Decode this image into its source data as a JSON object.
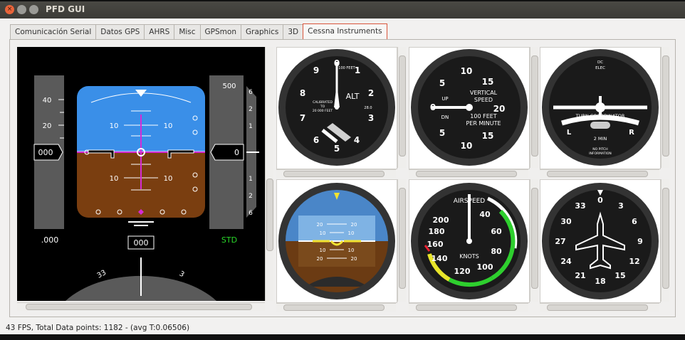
{
  "window": {
    "title": "PFD GUI",
    "close_glyph": "×"
  },
  "tabs": [
    "Comunicación Serial",
    "Datos GPS",
    "AHRS",
    "Misc",
    "GPSmon",
    "Graphics",
    "3D",
    "Cessna Instruments"
  ],
  "active_tab": 7,
  "status": {
    "text": "43 FPS, Total Data points: 1182 - (avg T:0.06506)"
  },
  "pfd": {
    "airspeed": "000",
    "airspeed_ticks": [
      "40",
      "20"
    ],
    "altitude": "0",
    "altitude_tick": "500",
    "vsi_ticks": [
      "6",
      "2",
      "1",
      "1",
      "2",
      "6"
    ],
    "mach": ".000",
    "baro": "STD",
    "heading": "000",
    "heading_ticks": [
      "33",
      "3"
    ],
    "pitch_labels": [
      "10",
      "10",
      "10",
      "10"
    ]
  },
  "gauges": {
    "altimeter": {
      "label": "ALT",
      "sub1": "100 FEET",
      "sub2": "CALIBRATED",
      "sub3": "TO",
      "sub4": "20 000 FEET",
      "baro": "28.0",
      "numbers": [
        "0",
        "1",
        "2",
        "3",
        "4",
        "5",
        "6",
        "7",
        "8",
        "9"
      ]
    },
    "vsi": {
      "top": "VERTICAL",
      "mid": "SPEED",
      "unit1": "100 FEET",
      "unit2": "PER MINUTE",
      "up": "UP",
      "dn": "DN",
      "numbers": [
        "0",
        "5",
        "10",
        "15",
        "20",
        "15",
        "10",
        "5"
      ]
    },
    "turn": {
      "top1": "DC",
      "top2": "ELEC",
      "label": "TURN COORDINATOR",
      "min": "2 MIN",
      "left": "L",
      "right": "R",
      "note1": "NO PITCH",
      "note2": "INFORMATION"
    },
    "attitude": {
      "labels": [
        "20",
        "20",
        "10",
        "10",
        "10",
        "10",
        "20",
        "20"
      ]
    },
    "airspeed": {
      "title": "AIRSPEED",
      "unit": "KNOTS",
      "numbers": [
        "40",
        "60",
        "80",
        "100",
        "120",
        "140",
        "160",
        "180",
        "200"
      ]
    },
    "heading": {
      "numbers": [
        "0",
        "3",
        "6",
        "9",
        "12",
        "15",
        "18",
        "21",
        "24",
        "27",
        "30",
        "33"
      ]
    }
  }
}
